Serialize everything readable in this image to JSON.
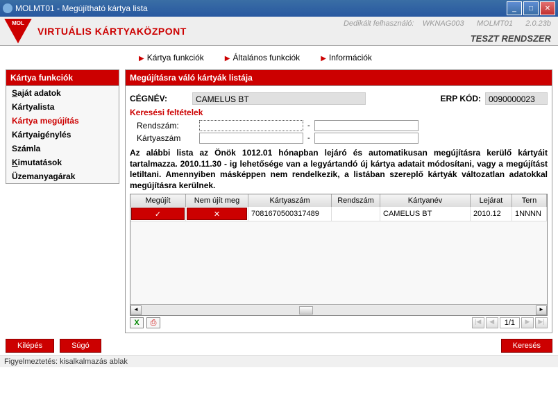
{
  "window": {
    "title": "MOLMT01 - Megújítható kártya lista"
  },
  "header": {
    "app_name": "VIRTUÁLIS KÁRTYAKÖZPONT",
    "user_label": "Dedikált felhasználó:",
    "user": "WKNAG003",
    "terminal": "MOLMT01",
    "version": "2.0.23b",
    "brand2": "TESZT RENDSZER"
  },
  "tabs": [
    "Kártya funkciók",
    "Általános funkciók",
    "Információk"
  ],
  "sidebar": {
    "title": "Kártya funkciók",
    "items": [
      "Saját adatok",
      "Kártyalista",
      "Kártya megújítás",
      "Kártyaigénylés",
      "Számla",
      "Kimutatások",
      "Üzemanyagárak"
    ],
    "active_index": 2
  },
  "page": {
    "title": "Megújításra váló kártyák listája",
    "cegnev_label": "CÉGNÉV:",
    "cegnev": "CAMELUS BT",
    "erp_label": "ERP KÓD:",
    "erp": "0090000023",
    "criteria_title": "Keresési feltételek",
    "rendszam_label": "Rendszám:",
    "kartyaszam_label": "Kártyaszám",
    "info": "Az alábbi lista az Önök 1012.01 hónapban lejáró és automatikusan megújításra kerülő kártyáit tartalmazza. 2010.11.30 - ig lehetősége van a legyártandó új kártya adatait módosítani, vagy a megújítást letiltani. Amennyiben másképpen nem rendelkezik, a listában szereplő kártyák változatlan adatokkal megújításra kerülnek."
  },
  "grid": {
    "headers": [
      "Megújít",
      "Nem újít meg",
      "Kártyaszám",
      "Rendszám",
      "Kártyanév",
      "Lejárat",
      "Tern"
    ],
    "rows": [
      {
        "kartyaszam": "7081670500317489",
        "rendszam": "",
        "kartyanev": "CAMELUS BT",
        "lejarat": "2010.12",
        "term": "1NNNN"
      }
    ],
    "pager": "1/1"
  },
  "footer": {
    "exit": "Kilépés",
    "help": "Súgó",
    "search": "Keresés"
  },
  "status": "Figyelmeztetés: kisalkalmazás ablak"
}
